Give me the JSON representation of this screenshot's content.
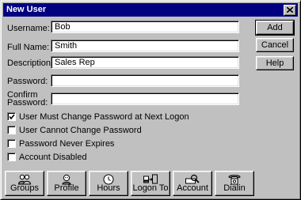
{
  "window": {
    "title": "New User"
  },
  "fields": {
    "username": {
      "label": "Username:",
      "value": "Bob"
    },
    "fullname": {
      "label": "Full Name:",
      "value": "Smith"
    },
    "description": {
      "label": "Description:",
      "value": "Sales Rep"
    },
    "password": {
      "label": "Password:",
      "value": ""
    },
    "confirm": {
      "label_line1": "Confirm",
      "label_line2": "Password:",
      "value": ""
    }
  },
  "buttons": {
    "add": "Add",
    "cancel": "Cancel",
    "help": "Help"
  },
  "checkboxes": [
    {
      "label": "User Must Change Password at Next Logon",
      "checked": true
    },
    {
      "label": "User Cannot Change Password",
      "checked": false
    },
    {
      "label": "Password Never Expires",
      "checked": false
    },
    {
      "label": "Account Disabled",
      "checked": false
    }
  ],
  "icon_buttons": [
    {
      "label": "Groups",
      "icon": "groups-icon"
    },
    {
      "label": "Profile",
      "icon": "profile-icon"
    },
    {
      "label": "Hours",
      "icon": "clock-icon"
    },
    {
      "label": "Logon To",
      "icon": "logon-to-icon"
    },
    {
      "label": "Account",
      "icon": "account-icon"
    },
    {
      "label": "Dialin",
      "icon": "phone-icon"
    }
  ]
}
